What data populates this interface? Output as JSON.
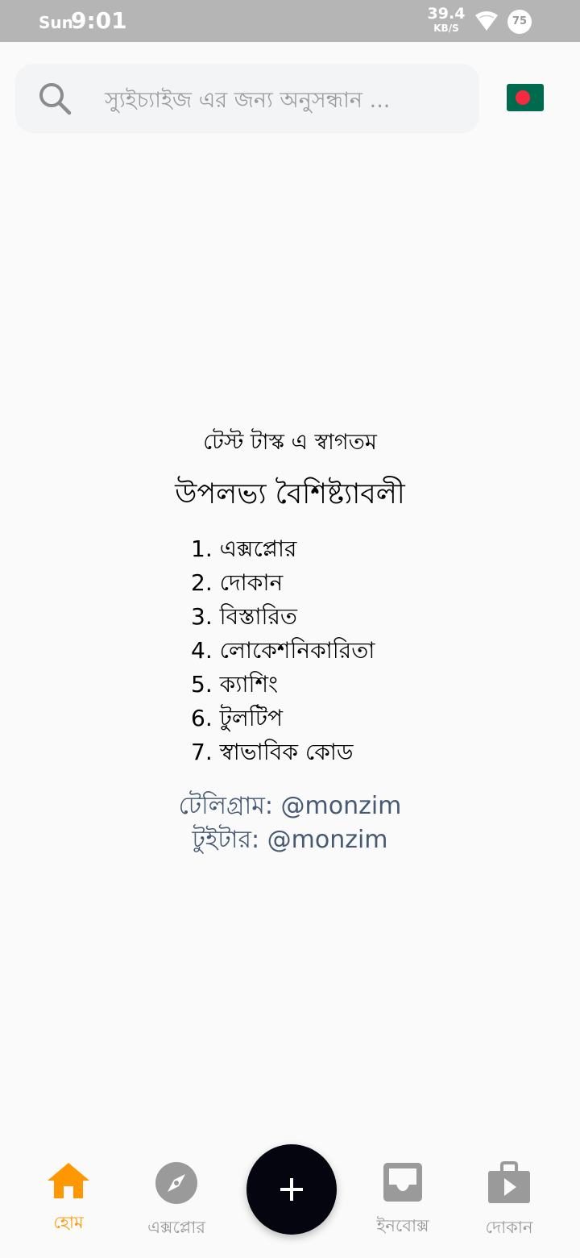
{
  "status_bar": {
    "day": "Sun",
    "time": "9:01",
    "net_speed_value": "39.4",
    "net_speed_unit": "KB/S",
    "battery_level": "75",
    "icons": [
      "wifi-icon",
      "battery-icon"
    ]
  },
  "search": {
    "placeholder": "স্যুইচ্যাইজ এর জন্য অনুসন্ধান ...",
    "icon": "search-icon"
  },
  "language_flag": {
    "icon": "bangladesh-flag-icon",
    "colors": {
      "green": "#006a4e",
      "red": "#f42a41"
    }
  },
  "content": {
    "welcome": "টেস্ট টাস্ক এ স্বাগতম",
    "features_title": "উপলভ্য বৈশিষ্ট্যাবলী",
    "features": [
      "1. এক্সপ্লোর",
      "2. দোকান",
      "3. বিস্তারিত",
      "4. লোকেশনিকারিতা",
      "5. ক্যাশিং",
      "6. টুলটিপ",
      "7. স্বাভাবিক কোড"
    ],
    "telegram": "টেলিগ্রাম: @monzim",
    "twitter": "টুইটার: @monzim"
  },
  "bottom_nav": {
    "home": "হোম",
    "explore": "এক্সপ্লোর",
    "inbox": "ইনবোক্স",
    "shop": "দোকান",
    "active": "home",
    "active_color": "#ff9800",
    "inactive_color": "#9a9a9a",
    "fab_icon": "plus-icon"
  }
}
